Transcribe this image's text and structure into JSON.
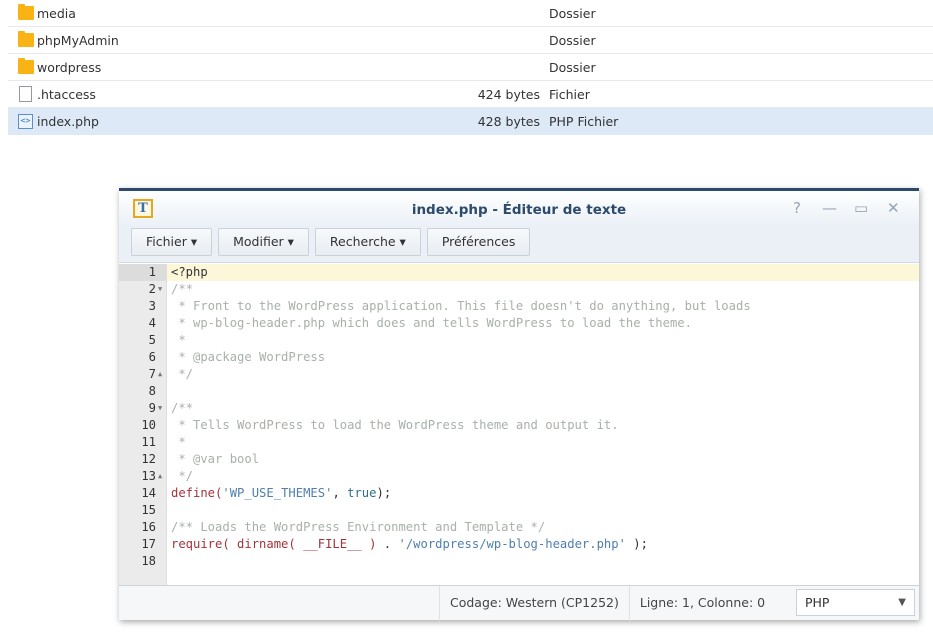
{
  "files": [
    {
      "name": "media",
      "size": "",
      "type": "Dossier",
      "icon": "folder-icon"
    },
    {
      "name": "phpMyAdmin",
      "size": "",
      "type": "Dossier",
      "icon": "folder-icon"
    },
    {
      "name": "wordpress",
      "size": "",
      "type": "Dossier",
      "icon": "folder-icon"
    },
    {
      "name": ".htaccess",
      "size": "424 bytes",
      "type": "Fichier",
      "icon": "file-icon"
    },
    {
      "name": "index.php",
      "size": "428 bytes",
      "type": "PHP Fichier",
      "icon": "php-file-icon",
      "selected": true
    }
  ],
  "window": {
    "title": "index.php - Éditeur de texte",
    "controls": {
      "help": "?",
      "minimize": "—",
      "maximize": "▭",
      "close": "✕"
    },
    "menu": [
      "Fichier ▾",
      "Modifier ▾",
      "Recherche ▾",
      "Préférences"
    ],
    "code": [
      {
        "n": "1",
        "tokens": [
          [
            "tx",
            "<?php"
          ]
        ]
      },
      {
        "n": "2",
        "fold": "▼",
        "tokens": [
          [
            "cm",
            "/**"
          ]
        ]
      },
      {
        "n": "3",
        "tokens": [
          [
            "cm",
            " * Front to the WordPress application. This file doesn't do anything, but loads"
          ]
        ]
      },
      {
        "n": "4",
        "tokens": [
          [
            "cm",
            " * wp-blog-header.php which does and tells WordPress to load the theme."
          ]
        ]
      },
      {
        "n": "5",
        "tokens": [
          [
            "cm",
            " *"
          ]
        ]
      },
      {
        "n": "6",
        "tokens": [
          [
            "cm",
            " * @package WordPress"
          ]
        ]
      },
      {
        "n": "7",
        "fold": "▲",
        "tokens": [
          [
            "cm",
            " */"
          ]
        ]
      },
      {
        "n": "8",
        "tokens": []
      },
      {
        "n": "9",
        "fold": "▼",
        "tokens": [
          [
            "cm",
            "/**"
          ]
        ]
      },
      {
        "n": "10",
        "tokens": [
          [
            "cm",
            " * Tells WordPress to load the WordPress theme and output it."
          ]
        ]
      },
      {
        "n": "11",
        "tokens": [
          [
            "cm",
            " *"
          ]
        ]
      },
      {
        "n": "12",
        "tokens": [
          [
            "cm",
            " * @var bool"
          ]
        ]
      },
      {
        "n": "13",
        "fold": "▲",
        "tokens": [
          [
            "cm",
            " */"
          ]
        ]
      },
      {
        "n": "14",
        "tokens": [
          [
            "kw",
            "define("
          ],
          [
            "str",
            "'WP_USE_THEMES'"
          ],
          [
            "tx",
            ", "
          ],
          [
            "bool",
            "true"
          ],
          [
            "tx",
            ");"
          ]
        ]
      },
      {
        "n": "15",
        "tokens": []
      },
      {
        "n": "16",
        "tokens": [
          [
            "cm",
            "/** Loads the WordPress Environment and Template */"
          ]
        ]
      },
      {
        "n": "17",
        "tokens": [
          [
            "kw",
            "require( dirname( __FILE__ ) "
          ],
          [
            "tx",
            ". "
          ],
          [
            "str",
            "'/wordpress/wp-blog-header.php'"
          ],
          [
            "tx",
            " );"
          ]
        ]
      },
      {
        "n": "18",
        "tokens": []
      }
    ],
    "status": {
      "encoding": "Codage: Western (CP1252)",
      "position": "Ligne: 1, Colonne: 0",
      "language": "PHP"
    }
  }
}
